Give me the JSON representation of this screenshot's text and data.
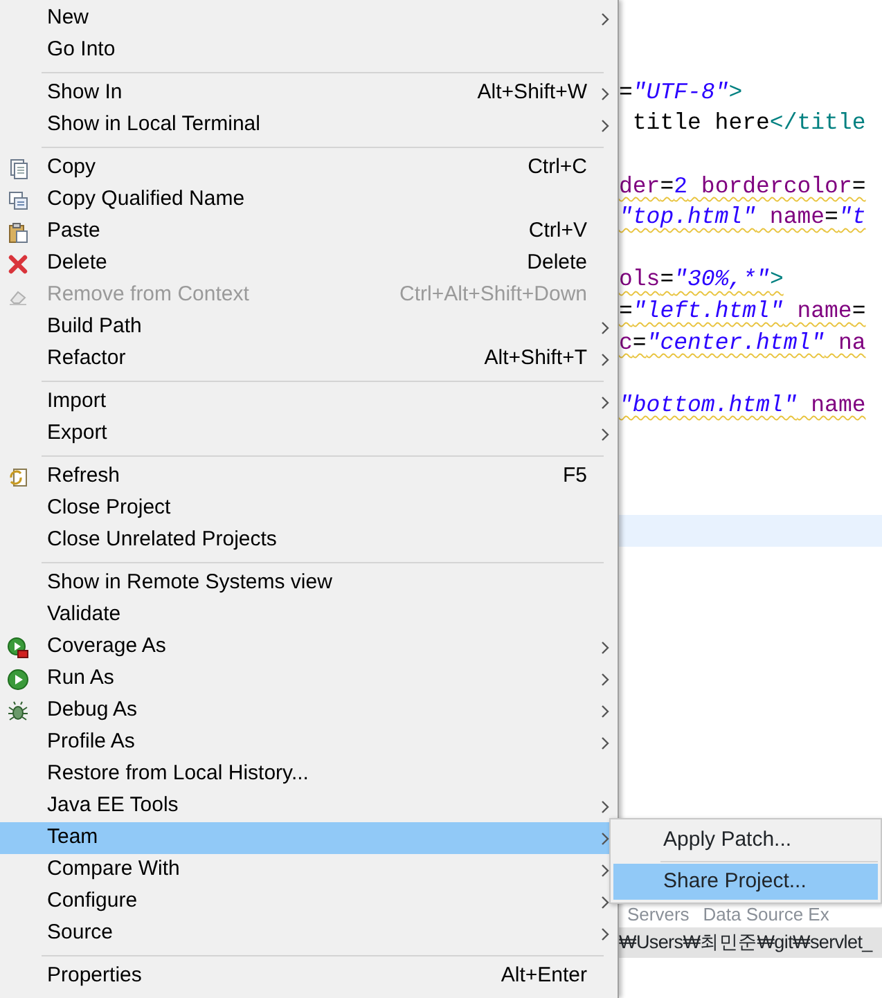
{
  "context_menu": {
    "items": [
      {
        "kind": "item",
        "label": "New",
        "submenu": true,
        "disabled": false,
        "selected": false
      },
      {
        "kind": "item",
        "label": "Go Into",
        "submenu": false,
        "disabled": false,
        "selected": false
      },
      {
        "kind": "separator"
      },
      {
        "kind": "item",
        "label": "Show In",
        "shortcut": "Alt+Shift+W",
        "submenu": true,
        "disabled": false,
        "selected": false
      },
      {
        "kind": "item",
        "label": "Show in Local Terminal",
        "submenu": true,
        "disabled": false,
        "selected": false
      },
      {
        "kind": "separator"
      },
      {
        "kind": "item",
        "label": "Copy",
        "shortcut": "Ctrl+C",
        "submenu": false,
        "disabled": false,
        "selected": false
      },
      {
        "kind": "item",
        "label": "Copy Qualified Name",
        "submenu": false,
        "disabled": false,
        "selected": false
      },
      {
        "kind": "item",
        "label": "Paste",
        "shortcut": "Ctrl+V",
        "submenu": false,
        "disabled": false,
        "selected": false
      },
      {
        "kind": "item",
        "label": "Delete",
        "shortcut": "Delete",
        "submenu": false,
        "disabled": false,
        "selected": false
      },
      {
        "kind": "item",
        "label": "Remove from Context",
        "shortcut": "Ctrl+Alt+Shift+Down",
        "submenu": false,
        "disabled": true,
        "selected": false
      },
      {
        "kind": "item",
        "label": "Build Path",
        "submenu": true,
        "disabled": false,
        "selected": false
      },
      {
        "kind": "item",
        "label": "Refactor",
        "shortcut": "Alt+Shift+T",
        "submenu": true,
        "disabled": false,
        "selected": false
      },
      {
        "kind": "separator"
      },
      {
        "kind": "item",
        "label": "Import",
        "submenu": true,
        "disabled": false,
        "selected": false
      },
      {
        "kind": "item",
        "label": "Export",
        "submenu": true,
        "disabled": false,
        "selected": false
      },
      {
        "kind": "separator"
      },
      {
        "kind": "item",
        "label": "Refresh",
        "shortcut": "F5",
        "submenu": false,
        "disabled": false,
        "selected": false
      },
      {
        "kind": "item",
        "label": "Close Project",
        "submenu": false,
        "disabled": false,
        "selected": false
      },
      {
        "kind": "item",
        "label": "Close Unrelated Projects",
        "submenu": false,
        "disabled": false,
        "selected": false
      },
      {
        "kind": "separator"
      },
      {
        "kind": "item",
        "label": "Show in Remote Systems view",
        "submenu": false,
        "disabled": false,
        "selected": false
      },
      {
        "kind": "item",
        "label": "Validate",
        "submenu": false,
        "disabled": false,
        "selected": false
      },
      {
        "kind": "item",
        "label": "Coverage As",
        "submenu": true,
        "disabled": false,
        "selected": false
      },
      {
        "kind": "item",
        "label": "Run As",
        "submenu": true,
        "disabled": false,
        "selected": false
      },
      {
        "kind": "item",
        "label": "Debug As",
        "submenu": true,
        "disabled": false,
        "selected": false
      },
      {
        "kind": "item",
        "label": "Profile As",
        "submenu": true,
        "disabled": false,
        "selected": false
      },
      {
        "kind": "item",
        "label": "Restore from Local History...",
        "submenu": false,
        "disabled": false,
        "selected": false
      },
      {
        "kind": "item",
        "label": "Java EE Tools",
        "submenu": true,
        "disabled": false,
        "selected": false
      },
      {
        "kind": "item",
        "label": "Team",
        "submenu": true,
        "disabled": false,
        "selected": true
      },
      {
        "kind": "item",
        "label": "Compare With",
        "submenu": true,
        "disabled": false,
        "selected": false
      },
      {
        "kind": "item",
        "label": "Configure",
        "submenu": true,
        "disabled": false,
        "selected": false
      },
      {
        "kind": "item",
        "label": "Source",
        "submenu": true,
        "disabled": false,
        "selected": false
      },
      {
        "kind": "separator"
      },
      {
        "kind": "item",
        "label": "Properties",
        "shortcut": "Alt+Enter",
        "submenu": false,
        "disabled": false,
        "selected": false
      }
    ]
  },
  "submenu": {
    "items": [
      {
        "kind": "item",
        "label": "Apply Patch...",
        "selected": false
      },
      {
        "kind": "separator"
      },
      {
        "kind": "item",
        "label": "Share Project...",
        "selected": true
      }
    ]
  },
  "editor": {
    "lines": [
      {
        "kind": "blank"
      },
      {
        "kind": "blank"
      },
      {
        "kind": "blank"
      },
      {
        "kind": "code",
        "warning": false,
        "segments": [
          {
            "kind": "plain",
            "text": "="
          },
          {
            "kind": "str",
            "text": "\"UTF-8\""
          },
          {
            "kind": "tag",
            "text": ">"
          }
        ]
      },
      {
        "kind": "code",
        "warning": false,
        "segments": [
          {
            "kind": "plain",
            "text": " title here"
          },
          {
            "kind": "tag",
            "text": "</title"
          }
        ]
      },
      {
        "kind": "blank"
      },
      {
        "kind": "code",
        "warning": true,
        "segments": [
          {
            "kind": "attr",
            "text": "der"
          },
          {
            "kind": "plain",
            "text": "="
          },
          {
            "kind": "num",
            "text": "2"
          },
          {
            "kind": "attr",
            "text": " bordercolor"
          },
          {
            "kind": "plain",
            "text": "="
          }
        ]
      },
      {
        "kind": "code",
        "warning": true,
        "segments": [
          {
            "kind": "str",
            "text": "\"top.html\""
          },
          {
            "kind": "attr",
            "text": " name"
          },
          {
            "kind": "plain",
            "text": "="
          },
          {
            "kind": "str",
            "text": "\"t"
          }
        ]
      },
      {
        "kind": "blank"
      },
      {
        "kind": "code",
        "warning": true,
        "segments": [
          {
            "kind": "attr",
            "text": "ols"
          },
          {
            "kind": "plain",
            "text": "="
          },
          {
            "kind": "str",
            "text": "\"30%,*\""
          },
          {
            "kind": "tag",
            "text": ">"
          }
        ]
      },
      {
        "kind": "code",
        "warning": true,
        "segments": [
          {
            "kind": "plain",
            "text": "="
          },
          {
            "kind": "str",
            "text": "\"left.html\""
          },
          {
            "kind": "attr",
            "text": " name"
          },
          {
            "kind": "plain",
            "text": "="
          }
        ]
      },
      {
        "kind": "code",
        "warning": true,
        "segments": [
          {
            "kind": "attr",
            "text": "c"
          },
          {
            "kind": "plain",
            "text": "="
          },
          {
            "kind": "str",
            "text": "\"center.html\""
          },
          {
            "kind": "attr",
            "text": " na"
          }
        ]
      },
      {
        "kind": "blank"
      },
      {
        "kind": "code",
        "warning": true,
        "segments": [
          {
            "kind": "str",
            "text": "\"bottom.html\""
          },
          {
            "kind": "attr",
            "text": " name"
          }
        ]
      },
      {
        "kind": "blank"
      },
      {
        "kind": "blank"
      },
      {
        "kind": "blank"
      },
      {
        "kind": "current"
      }
    ]
  },
  "bottom_tabs": [
    {
      "label": "Servers"
    },
    {
      "label": "Data Source Ex"
    }
  ],
  "path_bar": {
    "text": "₩Users₩최민준₩git₩servlet_"
  }
}
